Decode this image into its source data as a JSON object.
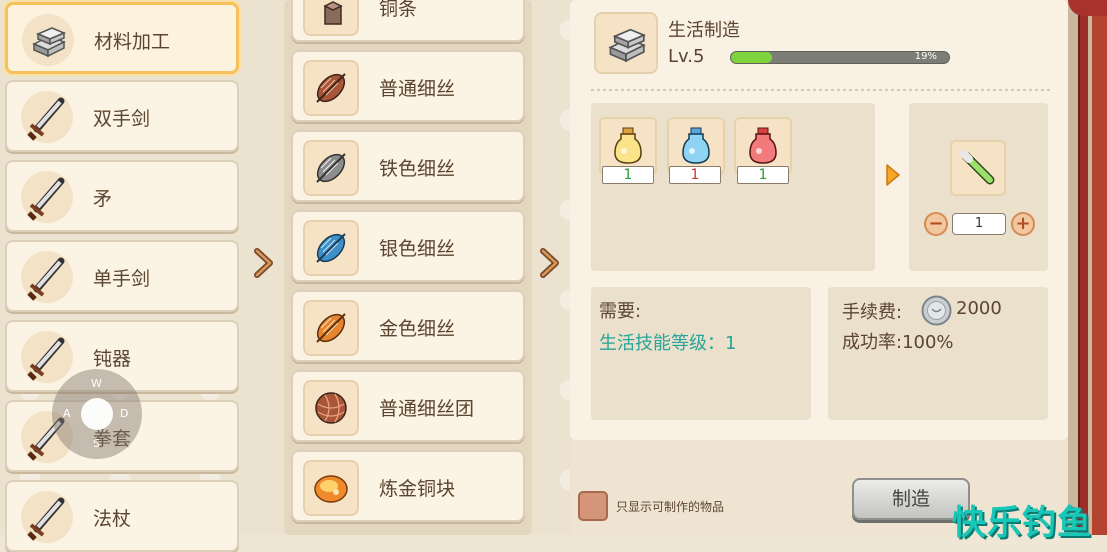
{
  "categories": [
    {
      "label": "材料加工",
      "icon": "ingot-icon",
      "active": true
    },
    {
      "label": "双手剑",
      "icon": "sword-icon"
    },
    {
      "label": "矛",
      "icon": "sword-icon"
    },
    {
      "label": "单手剑",
      "icon": "sword-icon"
    },
    {
      "label": "钝器",
      "icon": "sword-icon"
    },
    {
      "label": "拳套",
      "icon": "sword-icon"
    },
    {
      "label": "法杖",
      "icon": "sword-icon"
    }
  ],
  "materials": [
    {
      "label": "铜条",
      "icon": "copper-bar-icon"
    },
    {
      "label": "普通细丝",
      "icon": "thread-spool-icon"
    },
    {
      "label": "铁色细丝",
      "icon": "thread-spool-icon"
    },
    {
      "label": "银色细丝",
      "icon": "thread-spool-icon"
    },
    {
      "label": "金色细丝",
      "icon": "thread-spool-icon"
    },
    {
      "label": "普通细丝团",
      "icon": "yarn-ball-icon"
    },
    {
      "label": "炼金铜块",
      "icon": "ore-icon"
    }
  ],
  "skill": {
    "title": "生活制造",
    "level": "Lv.5",
    "progress_text": "19%",
    "progress": 0.19
  },
  "ingredients": [
    {
      "icon": "yellow-potion-icon",
      "count": "1",
      "count_color": "#2a9a3a"
    },
    {
      "icon": "blue-potion-icon",
      "count": "1",
      "count_color": "#d43030"
    },
    {
      "icon": "red-potion-icon",
      "count": "1",
      "count_color": "#2a9a3a"
    }
  ],
  "output": {
    "icon": "green-vial-icon",
    "quantity": "1"
  },
  "requirements": {
    "title": "需要:",
    "line": "生活技能等级：1"
  },
  "fee": {
    "label": "手续费:",
    "value": "2000",
    "rate_label": "成功率:",
    "rate_value": "100%"
  },
  "filter_label": "只显示可制作的物品",
  "make_button": "制造",
  "watermark": "快乐钓鱼",
  "joystick": {
    "up": "W",
    "left": "A",
    "right": "D",
    "down": "S"
  },
  "colors": {
    "accent": "#f6c05a",
    "progress": "#7fd33c",
    "requirement": "#27a59a",
    "watermark": "#19c7b8"
  }
}
